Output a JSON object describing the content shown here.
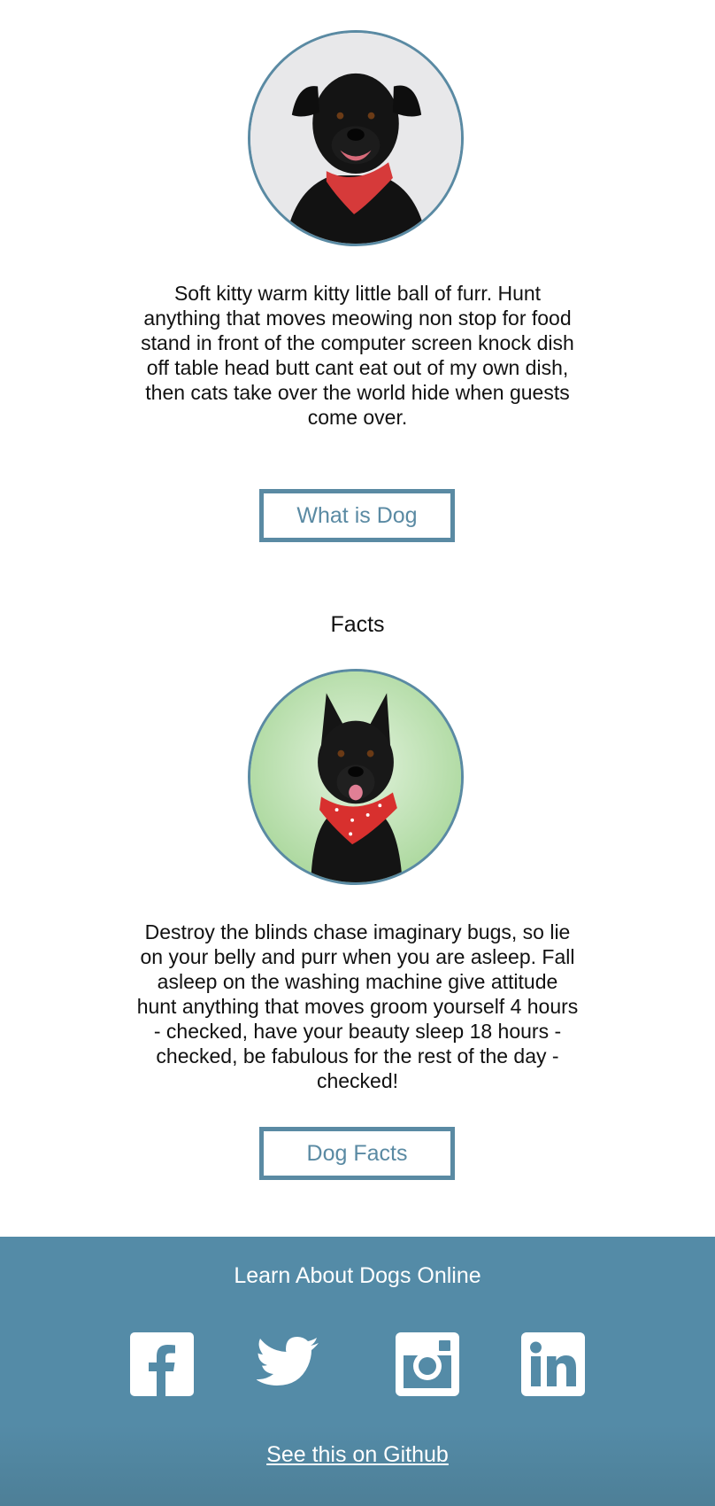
{
  "section1": {
    "avatar_alt": "black dog with red bandana",
    "paragraph": "Soft kitty warm kitty little ball of furr. Hunt anything that moves meowing non stop for food stand in front of the computer screen knock dish off table head butt cant eat out of my own dish, then cats take over the world hide when guests come over.",
    "button_label": "What is Dog"
  },
  "section2": {
    "heading": "Facts",
    "avatar_alt": "black dog with red polka-dot bandana",
    "paragraph": "Destroy the blinds chase imaginary bugs, so lie on your belly and purr when you are asleep. Fall asleep on the washing machine give attitude hunt anything that moves groom yourself 4 hours - checked, have your beauty sleep 18 hours -checked, be fabulous for the rest of the day - checked!",
    "button_label": "Dog Facts"
  },
  "footer": {
    "title": "Learn About Dogs Online",
    "social_icons": [
      "facebook-icon",
      "twitter-icon",
      "instagram-icon",
      "linkedin-icon"
    ],
    "github_link": "See this on Github"
  },
  "colors": {
    "accent": "#5a8aa3",
    "footer_bg": "#548ba7",
    "footer_text": "#ffffff"
  }
}
